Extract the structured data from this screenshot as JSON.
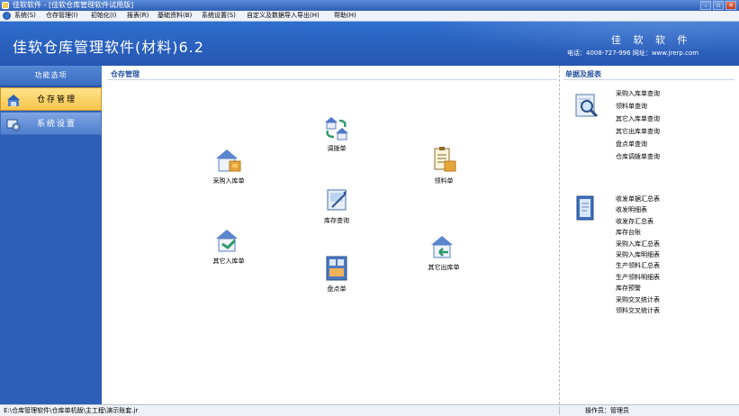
{
  "window": {
    "title": "佳软软件 - [佳软仓库管理软件试用版]"
  },
  "menu": [
    "系统(S)",
    "仓存管理(I)",
    "初始化(I)",
    "报表(R)",
    "基础资料(B)",
    "系统设置(S)",
    "自定义及数据导入导出(H)",
    "帮助(H)"
  ],
  "header": {
    "app_title": "佳软仓库管理软件(材料)6.2",
    "company": "佳 软 软 件",
    "contact": "电话：4008-727-996  网址：www.jrerp.com"
  },
  "left_panel": {
    "title": "功能选项",
    "items": [
      {
        "label": "仓存管理",
        "icon": "warehouse-icon",
        "active": true
      },
      {
        "label": "系统设置",
        "icon": "settings-icon",
        "active": false
      }
    ]
  },
  "center": {
    "title": "仓存管理",
    "functions": {
      "purchase_in": "采购入库单",
      "transfer": "调拨单",
      "material_out": "领料单",
      "stock_query": "库存查询",
      "other_in": "其它入库单",
      "inventory": "盘点单",
      "other_out": "其它出库单"
    }
  },
  "right": {
    "title": "单据及报表",
    "queries": [
      "采购入库单查询",
      "领料单查询",
      "其它入库单查询",
      "其它出库单查询",
      "盘点单查询",
      "仓库调拨单查询"
    ],
    "reports": [
      "收发单据汇总表",
      "收发明细表",
      "收发存汇总表",
      "库存台账",
      "采购入库汇总表",
      "采购入库明细表",
      "生产领料汇总表",
      "生产领料明细表",
      "库存预警",
      "采购交叉统计表",
      "领料交叉统计表"
    ]
  },
  "status": {
    "path": "E:\\仓库管理软件\\仓库单机版\\主工程\\演示账套.jr",
    "operator": "操作员：管理员"
  },
  "colors": {
    "header_blue": "#2b62c0",
    "panel_blue": "#2d5eb8",
    "active_tab": "#f7c54b"
  }
}
